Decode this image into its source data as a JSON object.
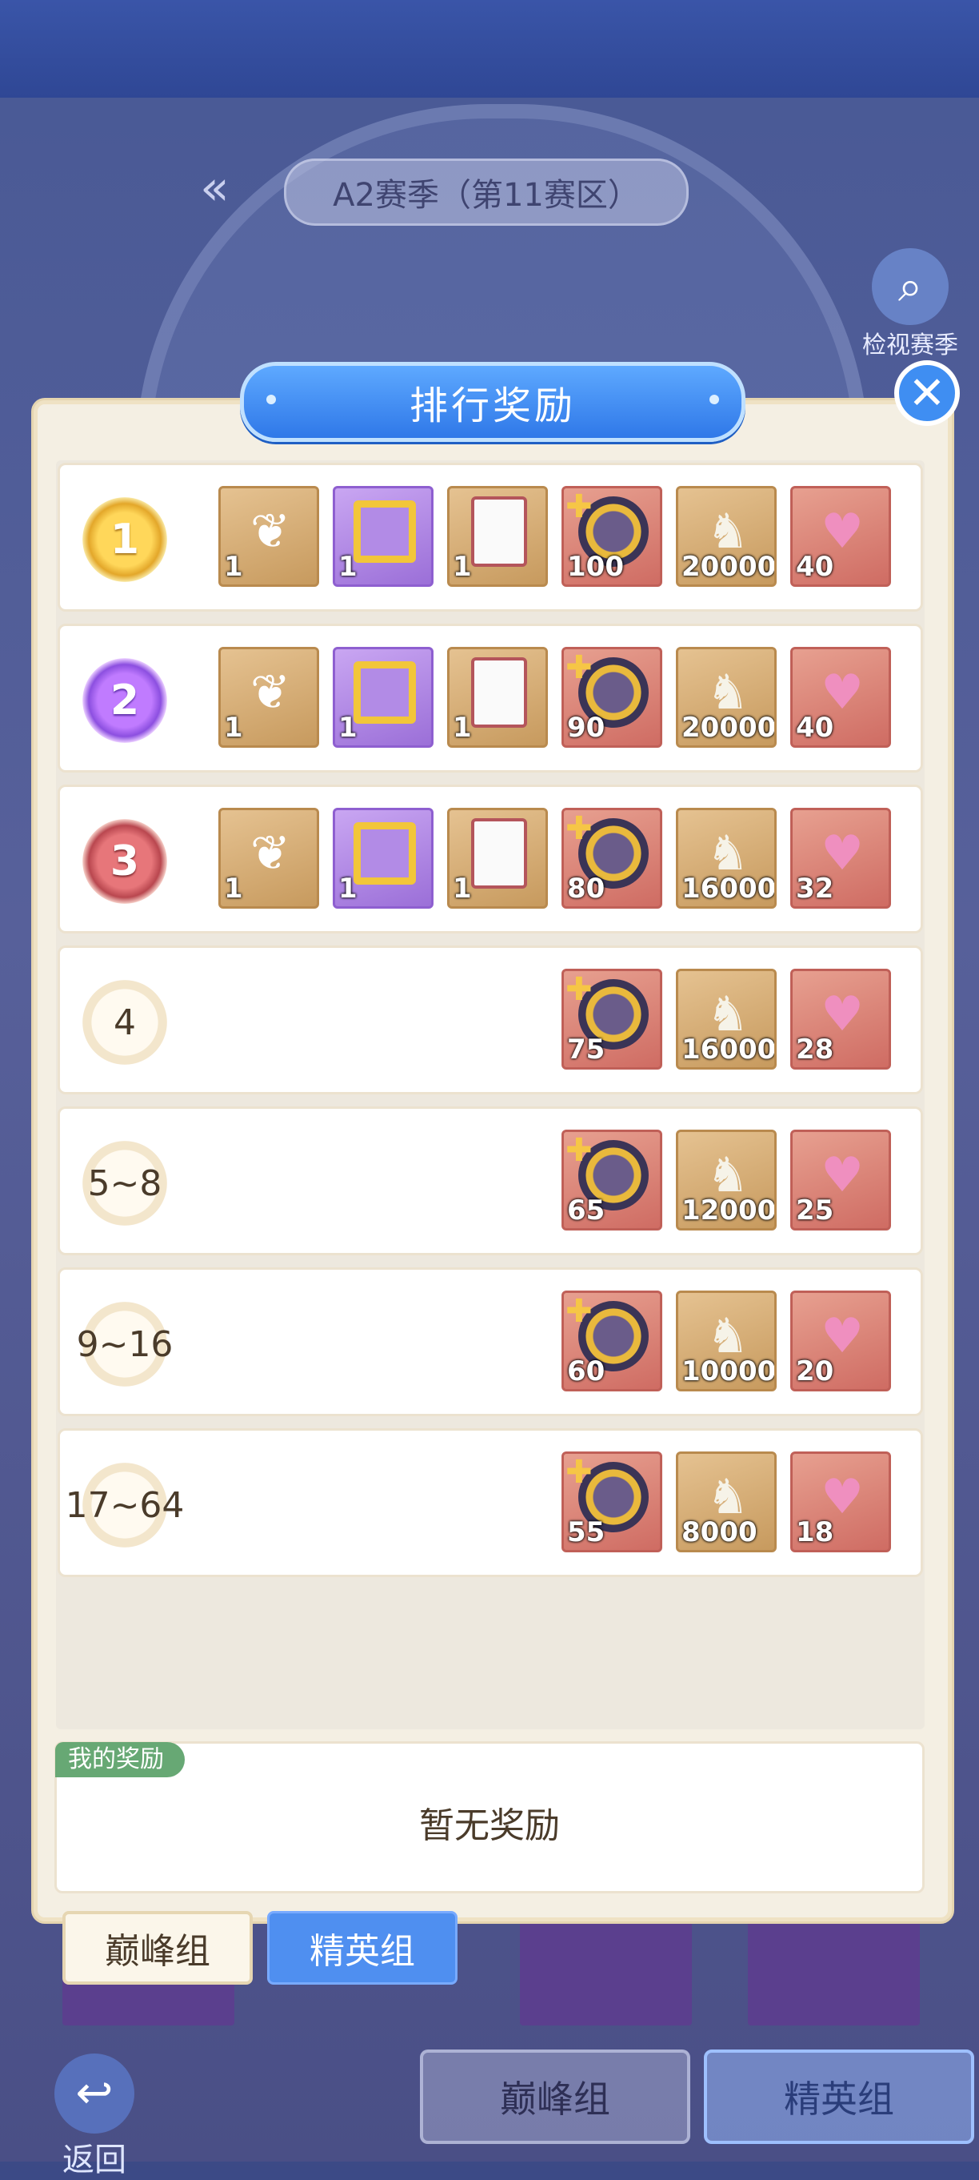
{
  "header": {
    "season_title": "A2赛季（第11赛区）",
    "view_season_label": "检视赛季"
  },
  "modal": {
    "title": "排行奖励",
    "close_icon": "close-icon"
  },
  "rewards": [
    {
      "rank": "1",
      "badge": "gold",
      "items": [
        {
          "icon": "wings-icon",
          "bg": "brown",
          "qty": "1"
        },
        {
          "icon": "frame-icon",
          "bg": "purple",
          "qty": "1"
        },
        {
          "icon": "scroll-icon",
          "bg": "brown",
          "qty": "1"
        },
        {
          "icon": "avatar-icon",
          "bg": "red",
          "qty": "100"
        },
        {
          "icon": "dragon-icon",
          "bg": "brown",
          "qty": "20000"
        },
        {
          "icon": "lips-icon",
          "bg": "red",
          "qty": "40"
        }
      ]
    },
    {
      "rank": "2",
      "badge": "purple",
      "items": [
        {
          "icon": "wings-icon",
          "bg": "brown",
          "qty": "1"
        },
        {
          "icon": "frame-icon",
          "bg": "purple",
          "qty": "1"
        },
        {
          "icon": "scroll-icon",
          "bg": "brown",
          "qty": "1"
        },
        {
          "icon": "avatar-icon",
          "bg": "red",
          "qty": "90"
        },
        {
          "icon": "dragon-icon",
          "bg": "brown",
          "qty": "20000"
        },
        {
          "icon": "lips-icon",
          "bg": "red",
          "qty": "40"
        }
      ]
    },
    {
      "rank": "3",
      "badge": "bronze",
      "items": [
        {
          "icon": "wings-icon",
          "bg": "brown",
          "qty": "1"
        },
        {
          "icon": "frame-icon",
          "bg": "purple",
          "qty": "1"
        },
        {
          "icon": "scroll-icon",
          "bg": "brown",
          "qty": "1"
        },
        {
          "icon": "avatar-icon",
          "bg": "red",
          "qty": "80"
        },
        {
          "icon": "dragon-icon",
          "bg": "brown",
          "qty": "16000"
        },
        {
          "icon": "lips-icon",
          "bg": "red",
          "qty": "32"
        }
      ]
    },
    {
      "rank": "4",
      "badge": "plain",
      "items": [
        {
          "icon": "avatar-icon",
          "bg": "red",
          "qty": "75"
        },
        {
          "icon": "dragon-icon",
          "bg": "brown",
          "qty": "16000"
        },
        {
          "icon": "lips-icon",
          "bg": "red",
          "qty": "28"
        }
      ]
    },
    {
      "rank": "5~8",
      "badge": "plain",
      "items": [
        {
          "icon": "avatar-icon",
          "bg": "red",
          "qty": "65"
        },
        {
          "icon": "dragon-icon",
          "bg": "brown",
          "qty": "12000"
        },
        {
          "icon": "lips-icon",
          "bg": "red",
          "qty": "25"
        }
      ]
    },
    {
      "rank": "9~16",
      "badge": "plain",
      "items": [
        {
          "icon": "avatar-icon",
          "bg": "red",
          "qty": "60"
        },
        {
          "icon": "dragon-icon",
          "bg": "brown",
          "qty": "10000"
        },
        {
          "icon": "lips-icon",
          "bg": "red",
          "qty": "20"
        }
      ]
    },
    {
      "rank": "17~64",
      "badge": "plain",
      "items": [
        {
          "icon": "avatar-icon",
          "bg": "red",
          "qty": "55"
        },
        {
          "icon": "dragon-icon",
          "bg": "brown",
          "qty": "8000"
        },
        {
          "icon": "lips-icon",
          "bg": "red",
          "qty": "18"
        }
      ]
    }
  ],
  "my_reward": {
    "tag": "我的奖励",
    "text": "暂无奖励"
  },
  "group_tabs": {
    "peak": "巅峰组",
    "elite": "精英组"
  },
  "bottom_tabs": {
    "peak": "巅峰组",
    "elite": "精英组"
  },
  "back_label": "返回"
}
